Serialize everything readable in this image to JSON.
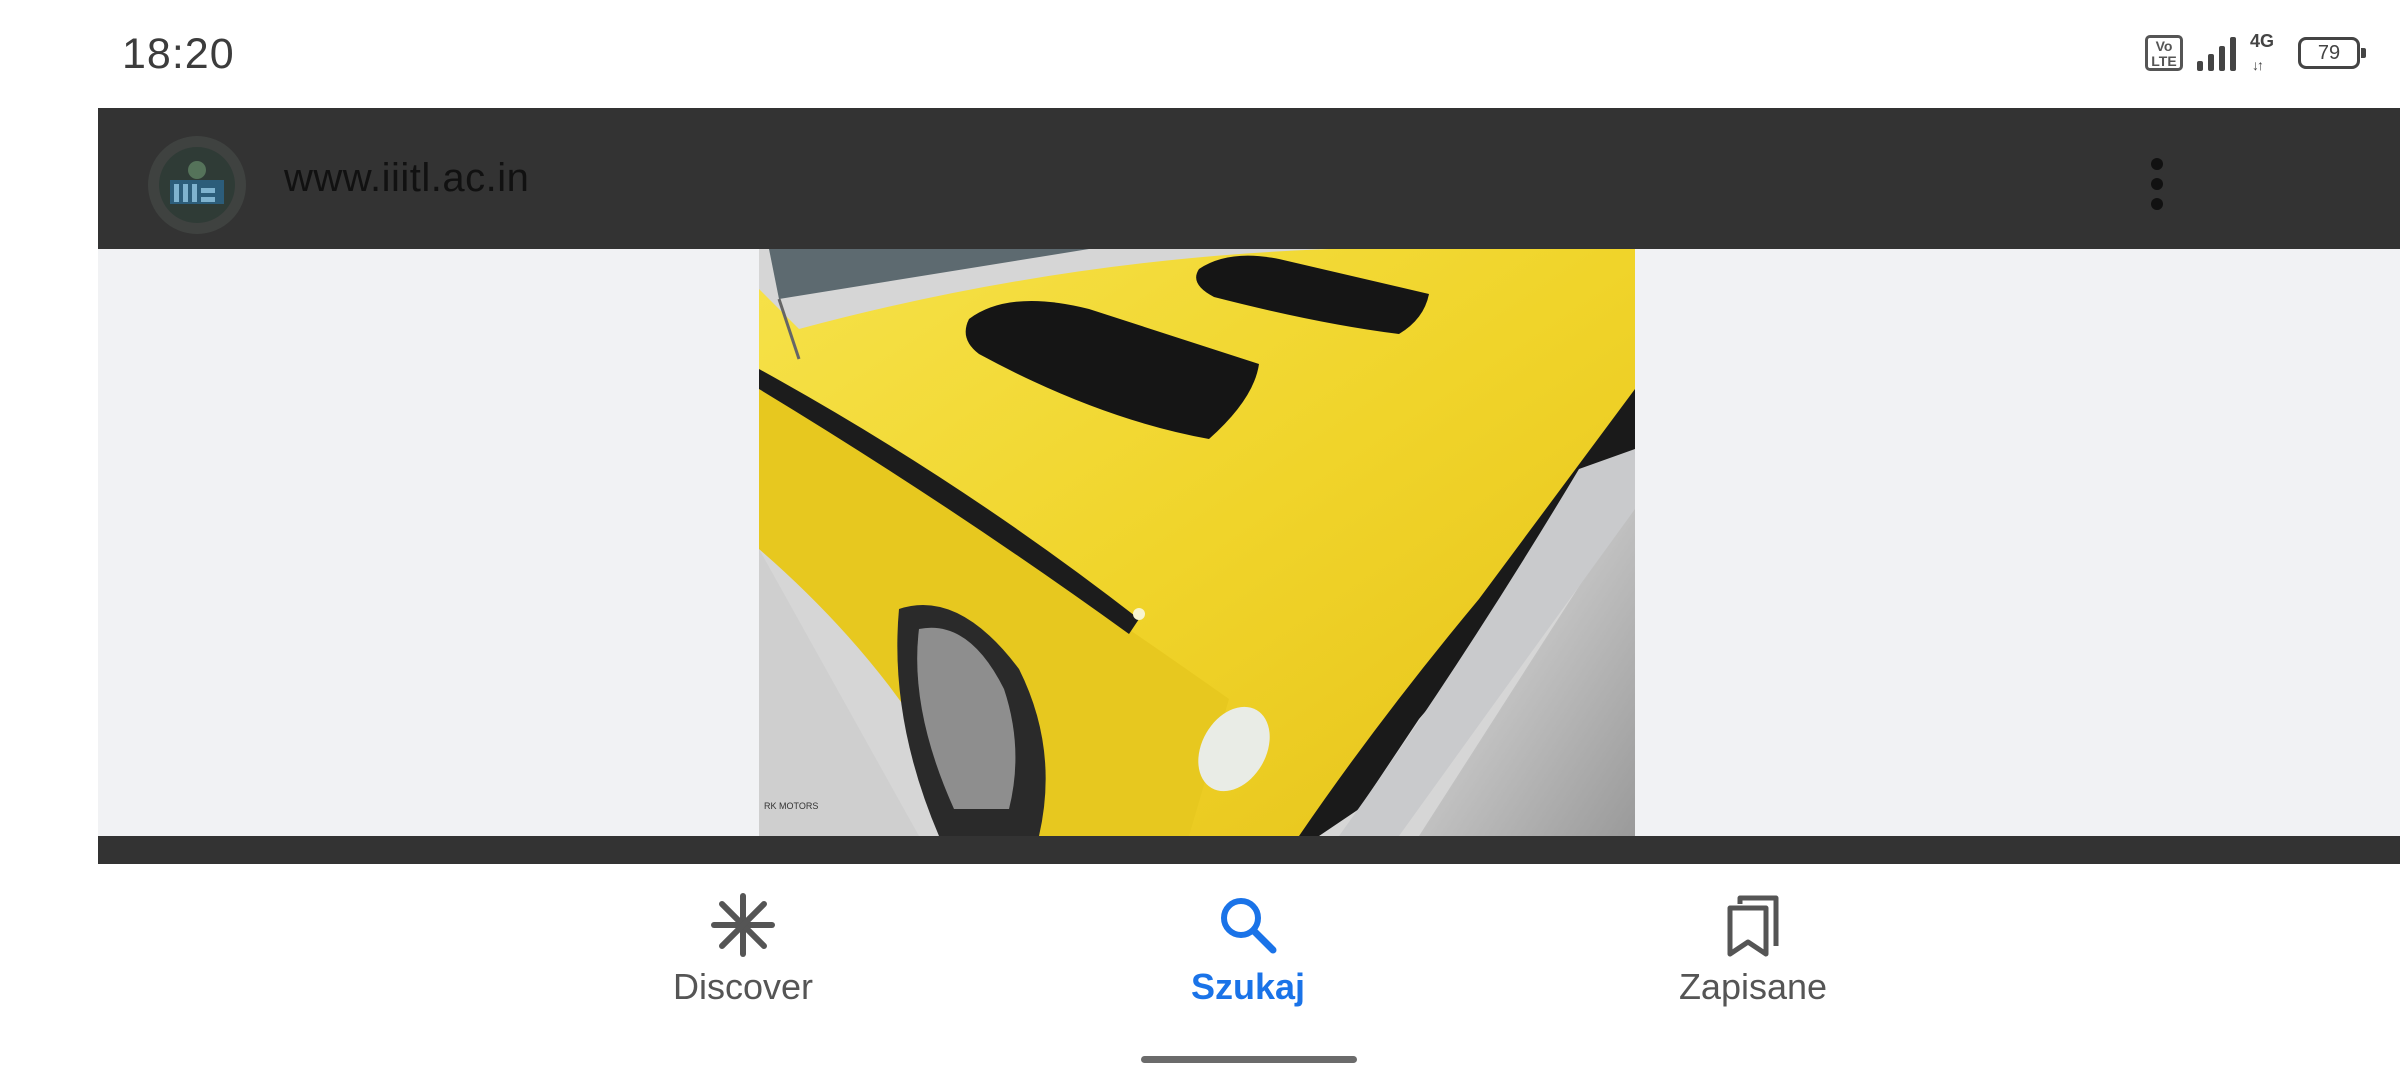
{
  "status_bar": {
    "time": "18:20",
    "volte_top": "Vo",
    "volte_bottom": "LTE",
    "network": "4G",
    "battery": "79"
  },
  "viewer": {
    "domain": "www.iiitl.ac.in",
    "more_icon": "more-vert-icon",
    "watermark": "RK MOTORS"
  },
  "bottom_nav": {
    "items": [
      {
        "label": "Discover",
        "icon": "asterisk-icon",
        "active": false
      },
      {
        "label": "Szukaj",
        "icon": "search-icon",
        "active": true
      },
      {
        "label": "Zapisane",
        "icon": "bookmarks-icon",
        "active": false
      }
    ],
    "active_color": "#1a73e8"
  }
}
